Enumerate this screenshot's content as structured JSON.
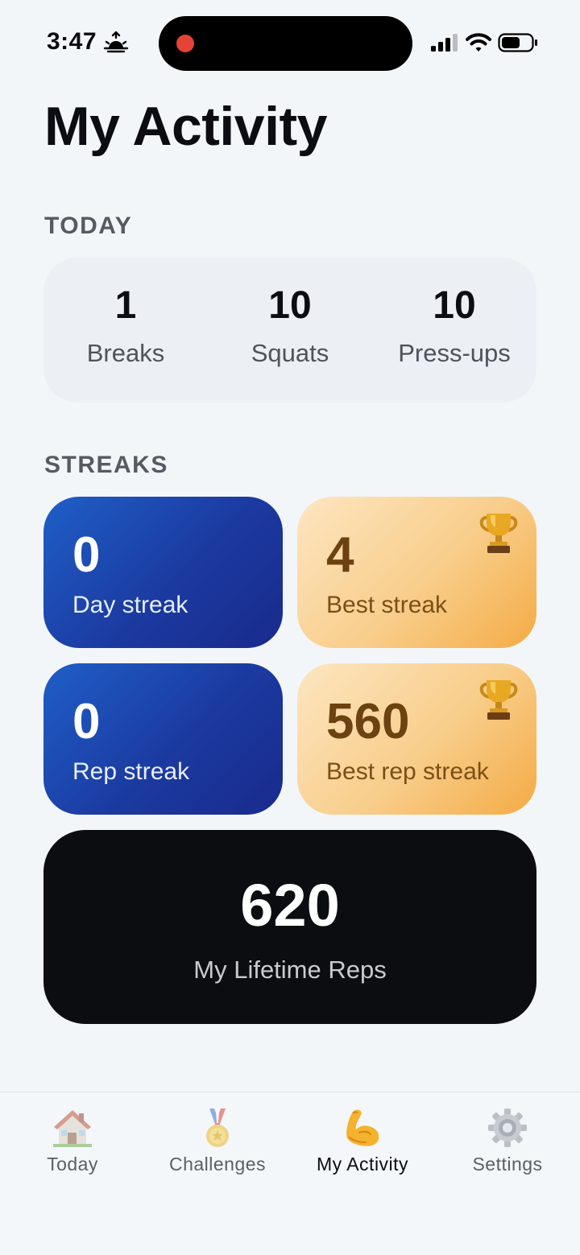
{
  "status_bar": {
    "time": "3:47"
  },
  "page_title": "My Activity",
  "today": {
    "label": "TODAY",
    "stats": [
      {
        "value": "1",
        "label": "Breaks"
      },
      {
        "value": "10",
        "label": "Squats"
      },
      {
        "value": "10",
        "label": "Press-ups"
      }
    ]
  },
  "streaks": {
    "label": "STREAKS",
    "day": {
      "value": "0",
      "label": "Day streak"
    },
    "best": {
      "value": "4",
      "label": "Best streak"
    },
    "rep": {
      "value": "0",
      "label": "Rep streak"
    },
    "best_rep": {
      "value": "560",
      "label": "Best rep streak"
    }
  },
  "lifetime": {
    "value": "620",
    "label": "My Lifetime Reps"
  },
  "tabs": [
    {
      "label": "Today",
      "icon": "house-icon"
    },
    {
      "label": "Challenges",
      "icon": "medal-icon"
    },
    {
      "label": "My Activity",
      "icon": "flexed-biceps-icon"
    },
    {
      "label": "Settings",
      "icon": "gear-icon"
    }
  ],
  "colors": {
    "background": "#f3f6f9",
    "streak_blue": "#1f5fc8",
    "streak_gold": "#f8cd8a",
    "lifetime_dark": "#0c0d10"
  }
}
